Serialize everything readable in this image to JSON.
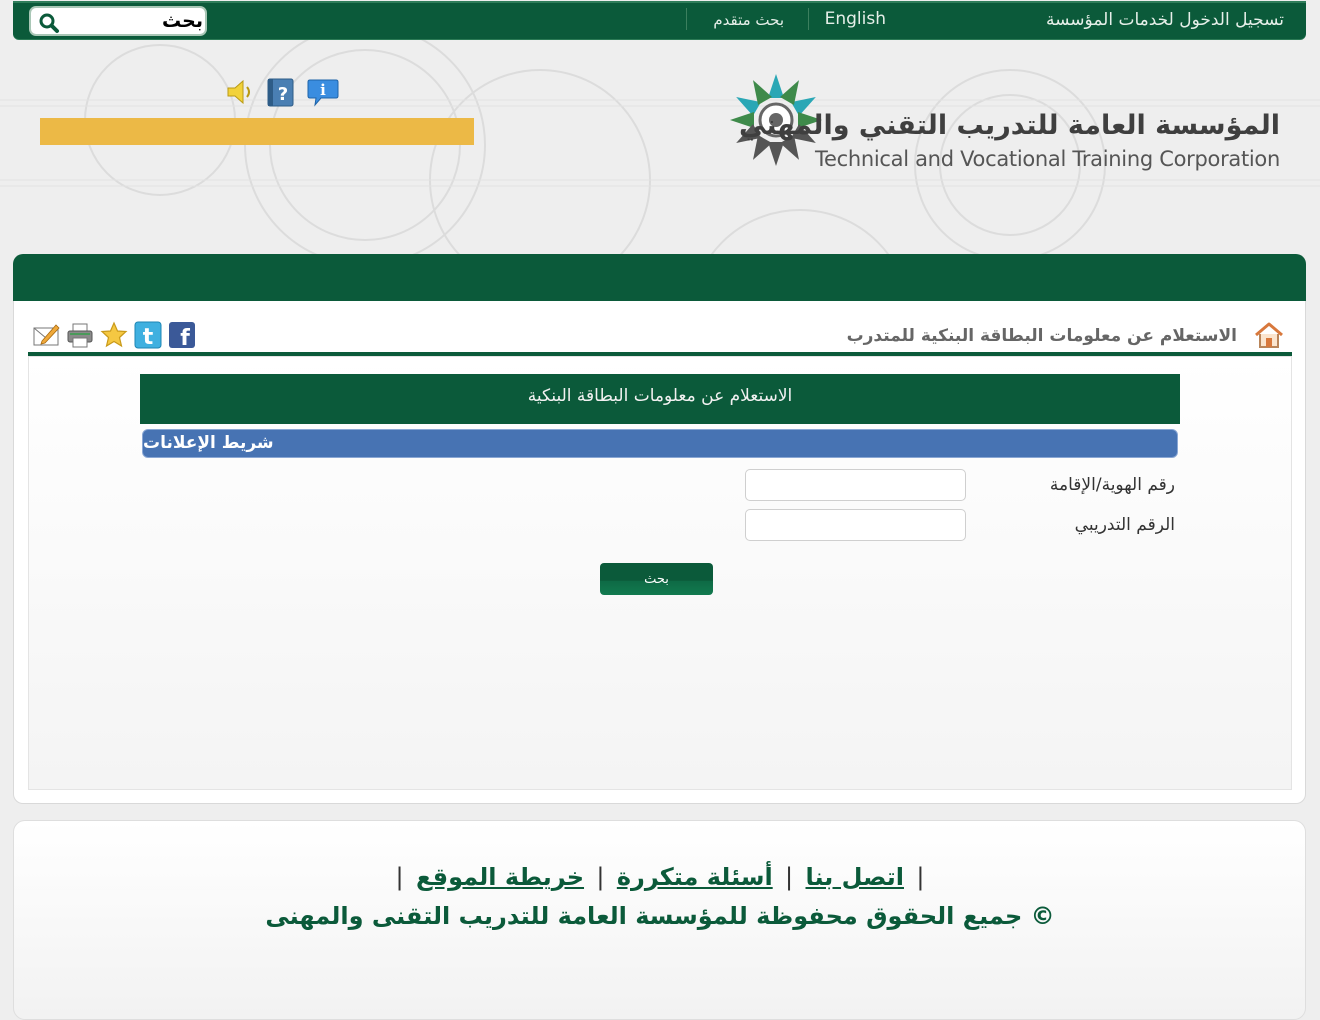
{
  "topbar": {
    "login_label": "تسجيل الدخول لخدمات المؤسسة",
    "english_label": "English",
    "advanced_search_label": "بحث متقدم",
    "search_value": "بحث"
  },
  "logo": {
    "arabic_name": "المؤسسة العامة للتدريب التقني والمهني",
    "english_name": "Technical and Vocational Training Corporation"
  },
  "icons": {
    "sound": "speaker-icon",
    "help": "help-icon",
    "info": "info-icon",
    "home": "home-icon",
    "share": [
      "facebook-icon",
      "twitter-icon",
      "favorite-star-icon",
      "print-icon",
      "email-icon"
    ]
  },
  "colors": {
    "brand_green": "#0b5a3a",
    "ticker_blue": "#4773b3",
    "accent_yellow": "#ecb946"
  },
  "page": {
    "breadcrumb": "الاستعلام عن معلومات البطاقة البنكية للمتدرب"
  },
  "form": {
    "header": "الاستعلام عن معلومات البطاقة البنكية",
    "ticker_text": "شريط الإعلانات",
    "fields": [
      {
        "label": "رقم الهوية/الإقامة",
        "value": ""
      },
      {
        "label": "الرقم التدريبي",
        "value": ""
      }
    ],
    "submit_label": "بحث"
  },
  "footer": {
    "links": [
      "اتصل بنا",
      "أسئلة متكررة",
      "خريطة الموقع"
    ],
    "copyright": "© جميع الحقوق محفوظة للمؤسسة العامة للتدريب التقنى والمهنى"
  }
}
